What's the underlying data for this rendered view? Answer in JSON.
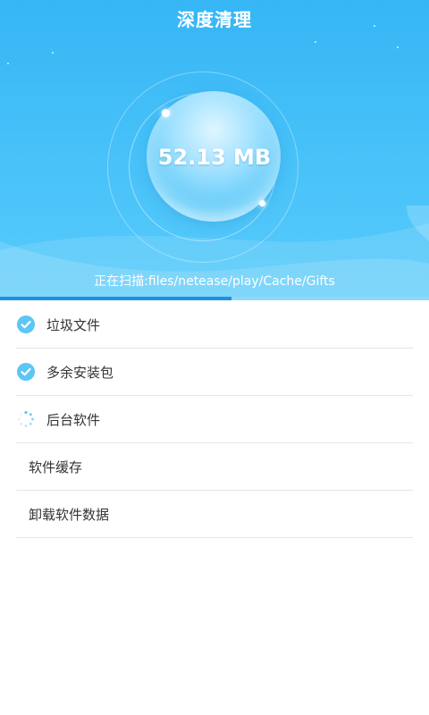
{
  "header": {
    "title": "深度清理",
    "size": "52.13 MB",
    "scan_text": "正在扫描:files/netease/play/Cache/Gifts",
    "progress_percent": 54
  },
  "items": [
    {
      "label": "垃圾文件",
      "status": "done",
      "icon": "check-circle-icon"
    },
    {
      "label": "多余安装包",
      "status": "done",
      "icon": "check-circle-icon"
    },
    {
      "label": "后台软件",
      "status": "scanning",
      "icon": "loading-spinner-icon"
    },
    {
      "label": "软件缓存",
      "status": "pending",
      "icon": ""
    },
    {
      "label": "卸载软件数据",
      "status": "pending",
      "icon": ""
    }
  ],
  "colors": {
    "accent": "#45c0f8",
    "check": "#5cc6f4",
    "progress": "#1f8fe0"
  }
}
